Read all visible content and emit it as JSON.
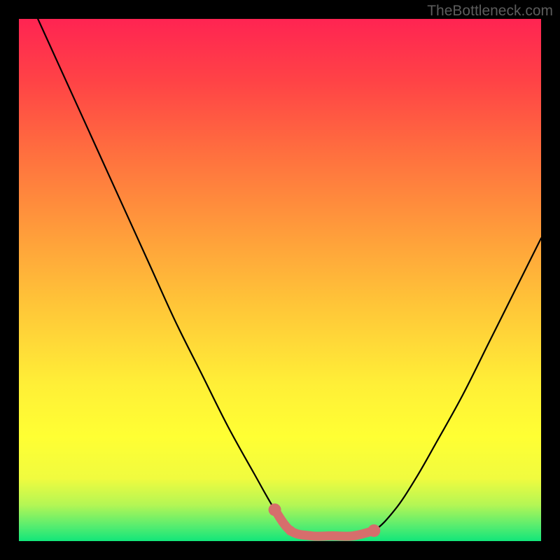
{
  "watermark": "TheBottleneck.com",
  "chart_data": {
    "type": "line",
    "title": "",
    "xlabel": "",
    "ylabel": "",
    "xlim": [
      0,
      100
    ],
    "ylim": [
      0,
      100
    ],
    "grid": false,
    "legend": false,
    "series": [
      {
        "name": "bottleneck-curve",
        "x": [
          0,
          5,
          10,
          15,
          20,
          25,
          30,
          35,
          40,
          45,
          49,
          52,
          56,
          60,
          64,
          68,
          72,
          76,
          80,
          85,
          90,
          95,
          100
        ],
        "y": [
          108,
          97,
          86,
          75,
          64,
          53,
          42,
          32,
          22,
          13,
          6,
          2,
          1,
          1,
          1,
          2,
          6,
          12,
          19,
          28,
          38,
          48,
          58
        ]
      }
    ],
    "highlight": {
      "name": "optimal-range",
      "x": [
        49,
        52,
        56,
        60,
        64,
        68
      ],
      "y": [
        6,
        2,
        1,
        1,
        1,
        2
      ]
    },
    "background_gradient": [
      {
        "pos": 0.0,
        "color": "#12e67a"
      },
      {
        "pos": 0.03,
        "color": "#59ed6f"
      },
      {
        "pos": 0.07,
        "color": "#b5f654"
      },
      {
        "pos": 0.12,
        "color": "#f0fb3f"
      },
      {
        "pos": 0.2,
        "color": "#ffff33"
      },
      {
        "pos": 0.3,
        "color": "#ffef37"
      },
      {
        "pos": 0.45,
        "color": "#ffc638"
      },
      {
        "pos": 0.6,
        "color": "#ff9a3b"
      },
      {
        "pos": 0.75,
        "color": "#ff6d3f"
      },
      {
        "pos": 0.88,
        "color": "#ff4346"
      },
      {
        "pos": 1.0,
        "color": "#ff2452"
      }
    ]
  }
}
